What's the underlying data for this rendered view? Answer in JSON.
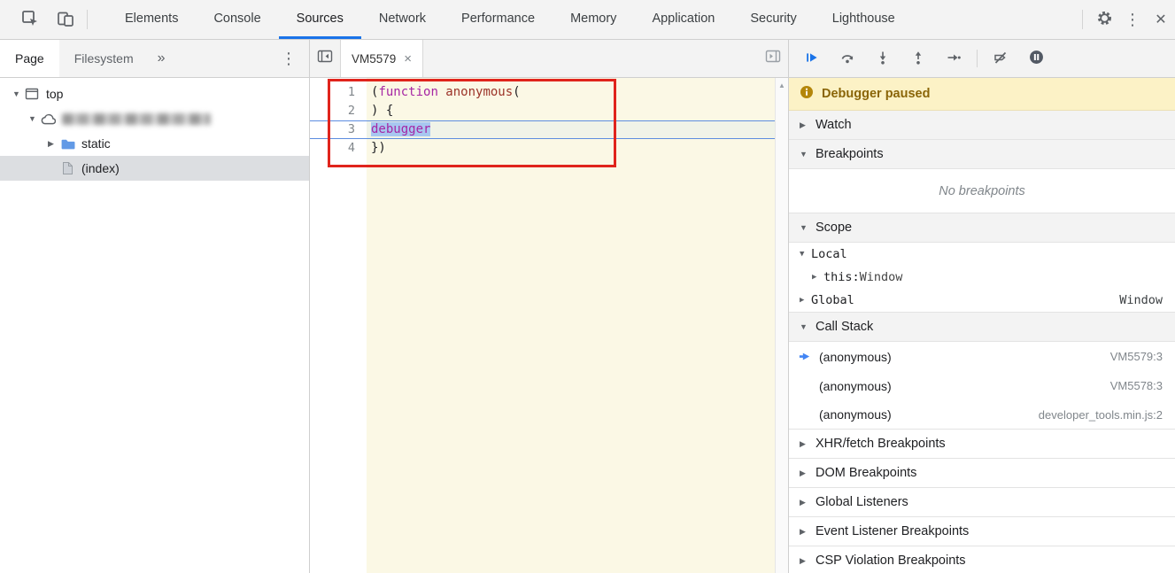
{
  "colors": {
    "accent_blue": "#1a73e8",
    "toolbar_bg": "#f3f3f3",
    "paused_banner_bg": "#fcf2c6",
    "paused_text": "#8a6508",
    "editor_bg": "#fbf8e5",
    "keyword_color": "#a626a4",
    "definition_color": "#9c3328",
    "selection_blue": "#a8c7f0",
    "execution_line_blue": "#5d8de0",
    "annotation_red": "#e0241c",
    "selected_tree_row_bg": "#dcdee1",
    "folder_icon_blue": "#629ae6"
  },
  "icons": {
    "overflow_chevron": "»",
    "kebab": "⋮",
    "window_close": "✕",
    "tab_close": "×",
    "triangle_down": "▼",
    "triangle_right": "▶",
    "scroll_up": "▲"
  },
  "main_toolbar": {
    "tabs": [
      {
        "label": "Elements"
      },
      {
        "label": "Console"
      },
      {
        "label": "Sources",
        "active": true
      },
      {
        "label": "Network"
      },
      {
        "label": "Performance"
      },
      {
        "label": "Memory"
      },
      {
        "label": "Application"
      },
      {
        "label": "Security"
      },
      {
        "label": "Lighthouse"
      }
    ]
  },
  "navigator": {
    "tabs": [
      {
        "label": "Page",
        "active": true
      },
      {
        "label": "Filesystem"
      }
    ],
    "tree": {
      "top": "top",
      "static": "static",
      "index": "(index)"
    }
  },
  "editor": {
    "tab_title": "VM5579",
    "lines": {
      "nums": [
        "1",
        "2",
        "3",
        "4"
      ],
      "l1_paren_open": "(",
      "l1_keyword": "function",
      "l1_name": " anonymous",
      "l1_paren2": "(",
      "l2": ") {",
      "l3_keyword": "debugger",
      "l4": "})"
    }
  },
  "debugger_pane": {
    "paused_message": "Debugger paused",
    "sections": {
      "watch": "Watch",
      "breakpoints": "Breakpoints",
      "no_breakpoints": "No breakpoints",
      "scope": "Scope",
      "call_stack": "Call Stack",
      "xhr": "XHR/fetch Breakpoints",
      "dom": "DOM Breakpoints",
      "global_listeners": "Global Listeners",
      "event_listener": "Event Listener Breakpoints",
      "csp": "CSP Violation Breakpoints"
    },
    "scope": {
      "local_label": "Local",
      "this_name": "this",
      "this_colon": ": ",
      "this_value": "Window",
      "global_label": "Global",
      "global_value": "Window"
    },
    "call_stack": [
      {
        "name": "(anonymous)",
        "location": "VM5579:3",
        "current": true
      },
      {
        "name": "(anonymous)",
        "location": "VM5578:3"
      },
      {
        "name": "(anonymous)",
        "location": "developer_tools.min.js:2"
      }
    ]
  }
}
